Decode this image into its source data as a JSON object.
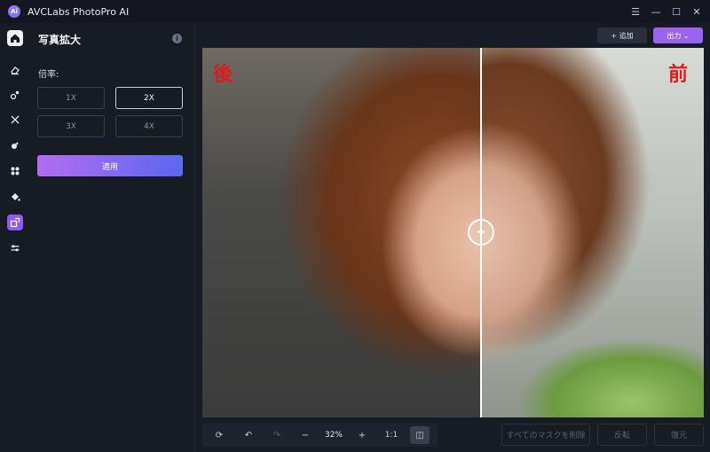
{
  "titlebar": {
    "logo_text": "Ai",
    "title": "AVCLabs PhotoPro AI",
    "controls": {
      "menu": "☰",
      "minimize": "—",
      "maximize": "☐",
      "close": "✕"
    }
  },
  "rail": {
    "icons": [
      "home-icon",
      "eraser-icon",
      "retouch-icon",
      "sharpen-icon",
      "background-icon",
      "colorize-icon",
      "fill-icon",
      "upscale-icon",
      "adjust-icon"
    ],
    "active": "upscale-icon"
  },
  "panel": {
    "title": "写真拡大",
    "info_icon": "i",
    "scale_label": "倍率:",
    "scale_options": [
      "1X",
      "2X",
      "3X",
      "4X"
    ],
    "selected_scale": "2X",
    "apply_label": "適用"
  },
  "topbar": {
    "add_label": "+ 追加",
    "export_label": "出力 ⌄"
  },
  "preview": {
    "label_after": "後",
    "label_before": "前",
    "handle_glyph": "◂▸"
  },
  "bottom": {
    "reset_icon": "⟳",
    "undo_icon": "↶",
    "redo_icon": "↷",
    "zoom_out": "−",
    "zoom_value": "32%",
    "zoom_in": "+",
    "actual_size": "1:1",
    "compare_icon": "◫",
    "delete_masks_label": "すべてのマスクを削除",
    "invert_label": "反転",
    "restore_label": "復元"
  },
  "colors": {
    "background": "#171b24",
    "accent": "#9a63f0",
    "label_red": "#e01b1b"
  }
}
